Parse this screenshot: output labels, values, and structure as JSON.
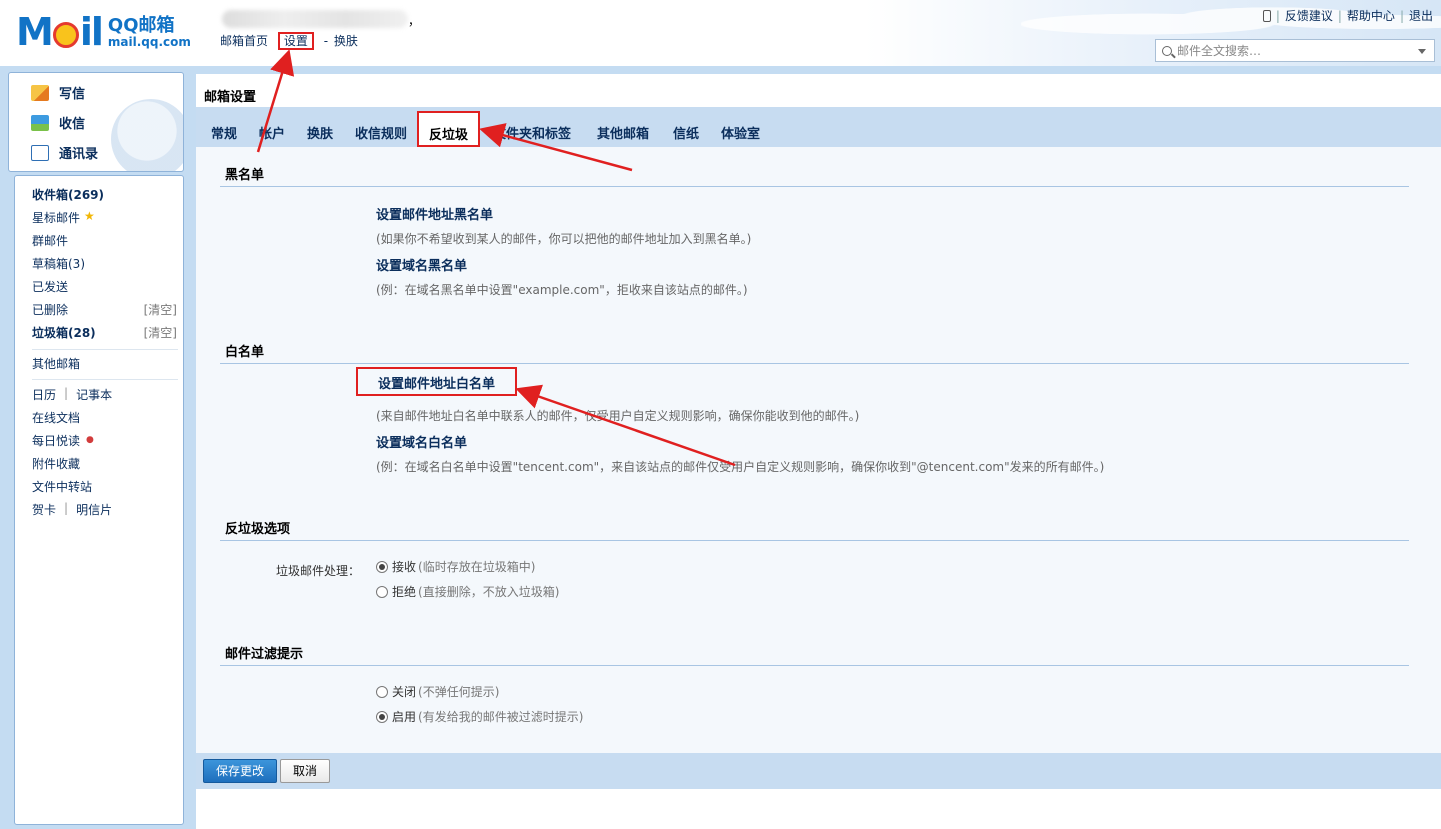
{
  "header": {
    "logo_mark": "M   il",
    "logo_title": "QQ邮箱",
    "logo_domain": "mail.qq.com",
    "user_suffix": "，",
    "links": [
      "邮箱首页",
      "设置",
      "换肤"
    ],
    "link_seps": [
      "|",
      "-"
    ],
    "right_links": [
      "反馈建议",
      "帮助中心",
      "退出"
    ],
    "search_placeholder": "邮件全文搜索…"
  },
  "sidebar": {
    "actions": [
      {
        "label": "写信",
        "icon": "pen-icon"
      },
      {
        "label": "收信",
        "icon": "inbox-download-icon"
      },
      {
        "label": "通讯录",
        "icon": "contacts-icon"
      }
    ],
    "folders": [
      {
        "label": "收件箱(269)",
        "bold": true
      },
      {
        "label": "星标邮件",
        "star": true
      },
      {
        "label": "群邮件"
      },
      {
        "label": "草稿箱(3)"
      },
      {
        "label": "已发送"
      },
      {
        "label": "已删除",
        "action": "[清空]"
      },
      {
        "label": "垃圾箱(28)",
        "bold": true,
        "action": "[清空]"
      }
    ],
    "other": "其他邮箱",
    "apps": {
      "calendar": "日历",
      "notes": "记事本",
      "docs": "在线文档",
      "reading": "每日悦读",
      "attachments": "附件收藏",
      "transfer": "文件中转站",
      "cards": "贺卡",
      "postcards": "明信片",
      "sep": "|"
    }
  },
  "main": {
    "title": "邮箱设置",
    "tabs": [
      "常规",
      "帐户",
      "换肤",
      "收信规则",
      "反垃圾",
      "文件夹和标签",
      "其他邮箱",
      "信纸",
      "体验室"
    ],
    "active_tab": "反垃圾",
    "blacklist": {
      "title": "黑名单",
      "addr_link": "设置邮件地址黑名单",
      "addr_hint": "(如果你不希望收到某人的邮件，你可以把他的邮件地址加入到黑名单。)",
      "domain_link": "设置域名黑名单",
      "domain_hint": "(例：在域名黑名单中设置\"example.com\"，拒收来自该站点的邮件。)"
    },
    "whitelist": {
      "title": "白名单",
      "addr_link": "设置邮件地址白名单",
      "addr_hint": "(来自邮件地址白名单中联系人的邮件，仅受用户自定义规则影响，确保你能收到他的邮件。)",
      "domain_link": "设置域名白名单",
      "domain_hint": "(例：在域名白名单中设置\"tencent.com\"，来自该站点的邮件仅受用户自定义规则影响，确保你收到\"@tencent.com\"发来的所有邮件。)"
    },
    "antispam": {
      "title": "反垃圾选项",
      "label": "垃圾邮件处理：",
      "accept": "接收",
      "accept_sub": "(临时存放在垃圾箱中)",
      "reject": "拒绝",
      "reject_sub": "(直接删除，不放入垃圾箱)",
      "selected": "accept"
    },
    "filter_tip": {
      "title": "邮件过滤提示",
      "off": "关闭",
      "off_sub": "(不弹任何提示)",
      "on": "启用",
      "on_sub": "(有发给我的邮件被过滤时提示)",
      "selected": "on"
    },
    "buttons": {
      "save": "保存更改",
      "cancel": "取消"
    }
  },
  "colors": {
    "accent": "#1173c6",
    "annotation": "#e02020",
    "frame": "#c4dcf2"
  }
}
